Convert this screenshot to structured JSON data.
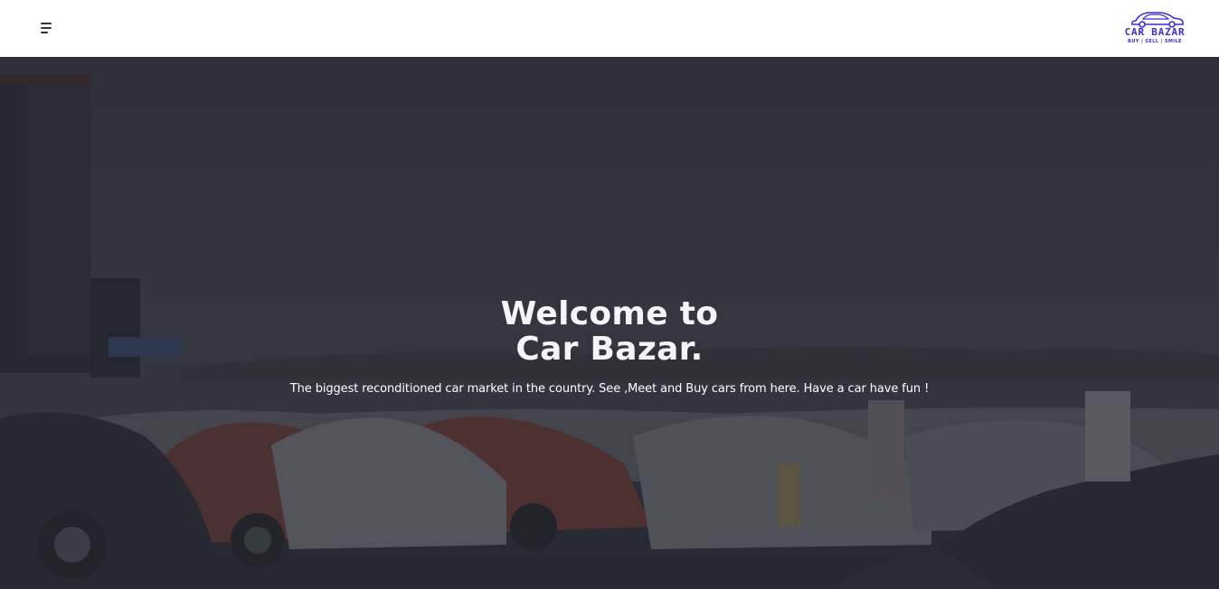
{
  "navbar": {
    "menu_icon": "hamburger-menu-icon",
    "logo": {
      "name": "CAR BAZAR",
      "tagline": "BUY | SELL | SMILE",
      "icon": "car-logo-icon",
      "color": "#3b2bd8"
    }
  },
  "hero": {
    "title_line1": "Welcome to",
    "title_line2": "Car Bazar.",
    "subtitle": "The biggest reconditioned car market in the country. See ,Meet and Buy cars from here. Have a car have fun !",
    "background": "car-show-parking-lot-photo",
    "overlay_color": "#24242e"
  }
}
